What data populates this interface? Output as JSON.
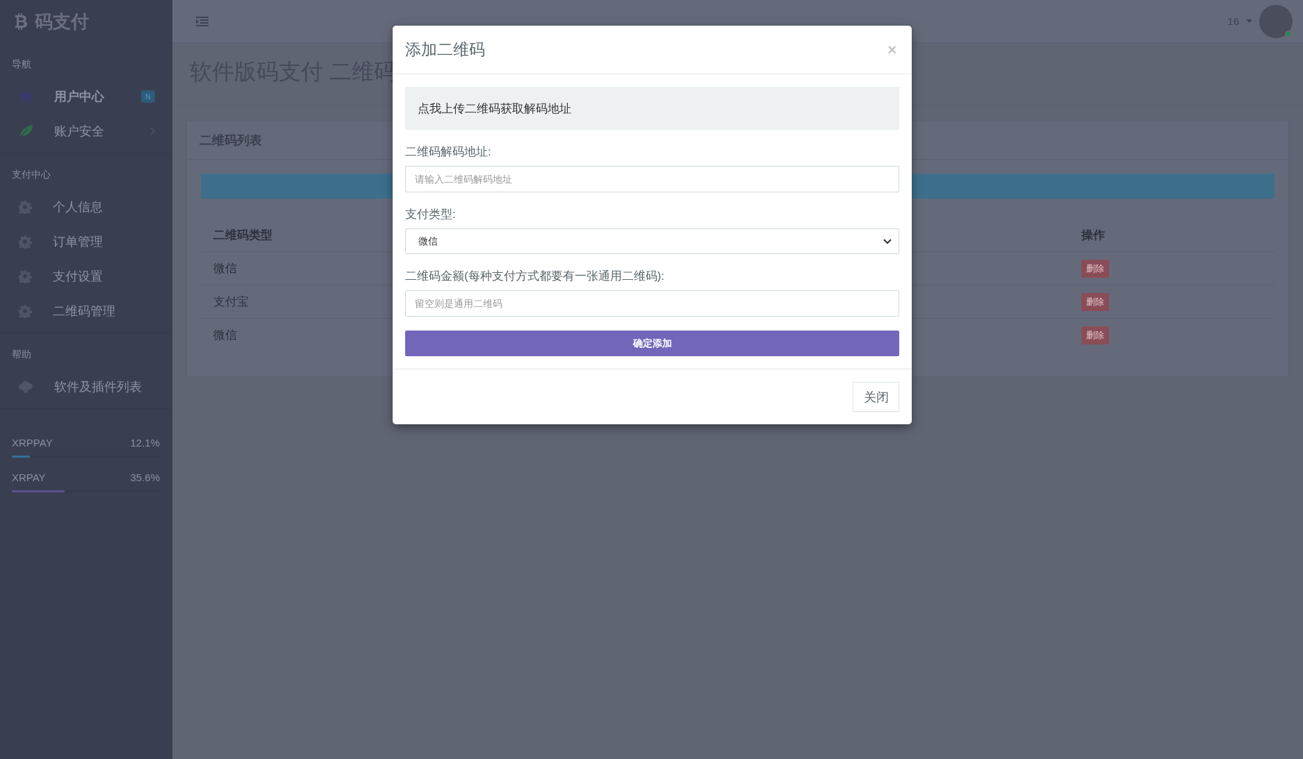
{
  "sidebar": {
    "brand": "码支付",
    "sections": [
      {
        "title": "导航",
        "items": [
          {
            "label": "用户中心",
            "kind": "home",
            "selected": true,
            "badge": "N"
          },
          {
            "label": "账户安全",
            "kind": "leaf",
            "selected": false,
            "expandable": true
          }
        ]
      },
      {
        "title": "支付中心",
        "items": [
          {
            "label": "个人信息",
            "kind": "gear",
            "selected": false
          },
          {
            "label": "订单管理",
            "kind": "gear",
            "selected": false
          },
          {
            "label": "支付设置",
            "kind": "gear",
            "selected": false
          },
          {
            "label": "二维码管理",
            "kind": "gear",
            "selected": false
          }
        ]
      },
      {
        "title": "帮助",
        "items": [
          {
            "label": "软件及插件列表",
            "kind": "cloud",
            "selected": false
          }
        ]
      }
    ],
    "meters": [
      {
        "name": "XRPPAY",
        "reading": "12.1%",
        "level": 0.121,
        "color": "#2f6f96"
      },
      {
        "name": "XRPAY",
        "reading": "35.6%",
        "level": 0.356,
        "color": "#5a4f8e"
      }
    ]
  },
  "header": {
    "user": "16"
  },
  "page_title": "软件版码支付 二维码",
  "panel": {
    "title": "二维码列表",
    "table": {
      "columns": [
        "二维码类型",
        "操作"
      ],
      "rows": [
        {
          "type": "微信",
          "action": "删除"
        },
        {
          "type": "支付宝",
          "action": "删除"
        },
        {
          "type": "微信",
          "action": "删除"
        }
      ]
    }
  },
  "modal": {
    "title": "添加二维码",
    "close": "×",
    "upload": "点我上传二维码获取解码地址",
    "fields": [
      {
        "kind": "input",
        "label": "二维码解码地址:",
        "placeholder": "请输入二维码解码地址"
      },
      {
        "kind": "select",
        "label": "支付类型:",
        "value": "微信"
      },
      {
        "kind": "input",
        "label": "二维码金额(每种支付方式都要有一张通用二维码):",
        "placeholder": "留空则是通用二维码"
      }
    ],
    "submit": "确定添加",
    "footer_button": "关闭"
  }
}
